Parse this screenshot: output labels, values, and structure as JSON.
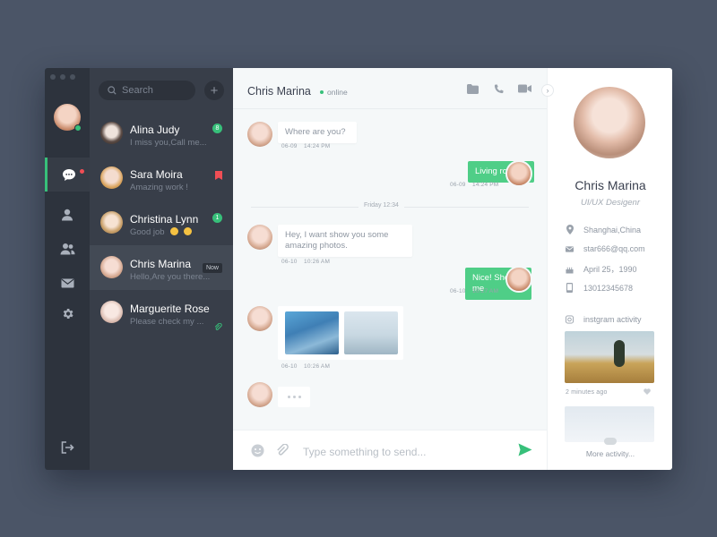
{
  "rail": {
    "items": [
      "chat-icon",
      "user-icon",
      "group-icon",
      "mail-icon",
      "gear-icon"
    ],
    "logout_icon": "logout-icon",
    "accent": "#37c07a"
  },
  "search": {
    "placeholder": "Search"
  },
  "contacts": [
    {
      "name": "Alina Judy",
      "preview": "I miss you,Call me...",
      "badge": "8"
    },
    {
      "name": "Sara Moira",
      "preview": "Amazing work !",
      "badge": "bookmark"
    },
    {
      "name": "Christina Lynn",
      "preview": "Good job",
      "badge": "1"
    },
    {
      "name": "Chris Marina",
      "preview": "Hello,Are you there...",
      "badge": "Now"
    },
    {
      "name": "Marguerite Rose",
      "preview": "Please check my ...",
      "badge": "attachment"
    }
  ],
  "chat": {
    "name": "Chris Marina",
    "status": "online",
    "messages": [
      {
        "dir": "in",
        "text": "Where are you?",
        "date": "06-09",
        "time": "14:24 PM"
      },
      {
        "dir": "out",
        "text": "Living room...",
        "date": "06-09",
        "time": "14:24 PM"
      },
      {
        "dir": "in",
        "text": "Hey, I want show you some amazing photos.",
        "date": "06-10",
        "time": "10:26 AM"
      },
      {
        "dir": "out",
        "text": "Nice! Show me",
        "date": "06-10",
        "time": "10:27 AM"
      },
      {
        "dir": "in",
        "text": "[photos]",
        "date": "06-10",
        "time": "10:26 AM"
      }
    ],
    "divider": "Friday 12:34",
    "composer_placeholder": "Type something to send..."
  },
  "profile": {
    "name": "Chris Marina",
    "title": "UI/UX Desigenr",
    "location": "Shanghai,China",
    "email": "star666@qq.com",
    "birthday": "April 25，1990",
    "phone": "13012345678",
    "insta_label": "instgram activity",
    "insta_time": "2 minutes ago",
    "more": "More activity..."
  }
}
